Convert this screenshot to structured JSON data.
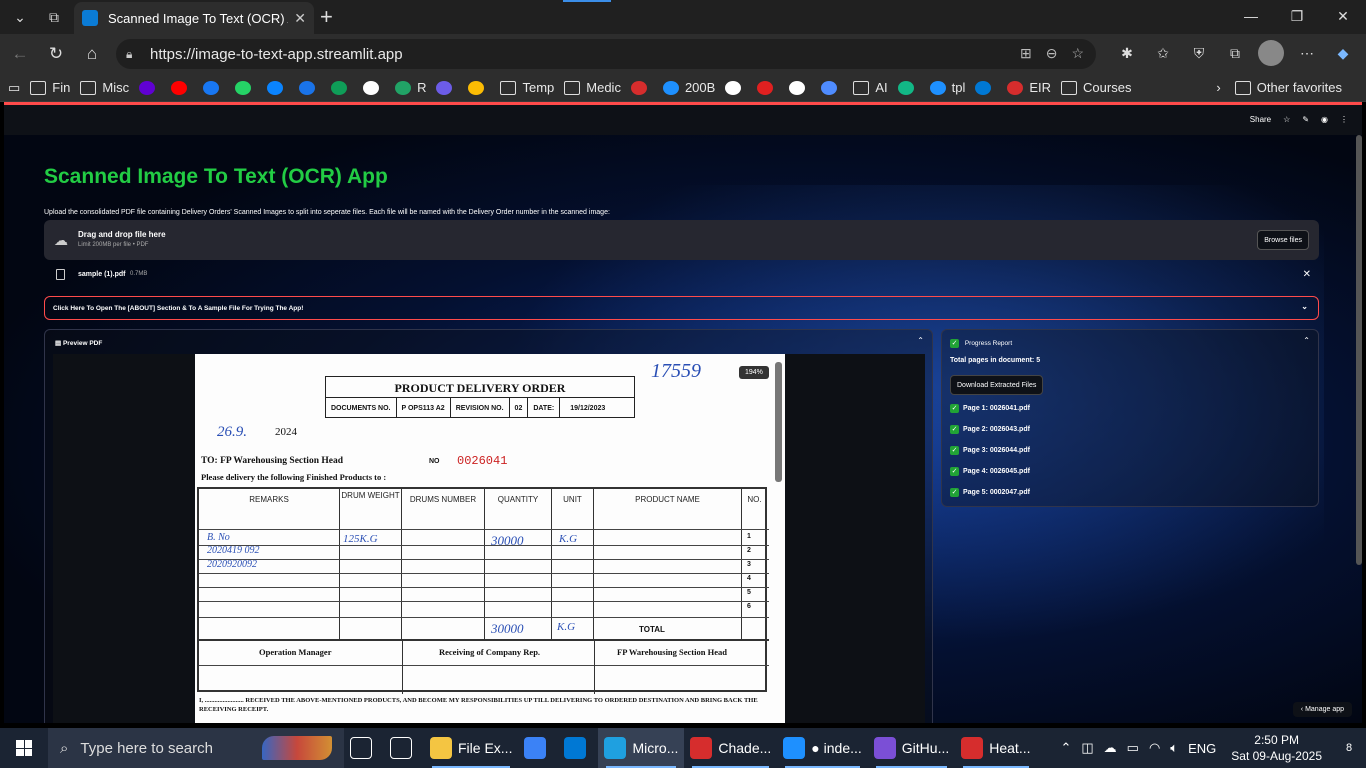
{
  "browser": {
    "tab_title": "Scanned Image To Text (OCR) App",
    "url": "https://image-to-text-app.streamlit.app",
    "favorites": [
      {
        "label": "Fin",
        "icon": "folder-icon"
      },
      {
        "label": "Misc",
        "icon": "folder-icon"
      },
      {
        "label": "",
        "icon": "yahoo-icon",
        "color": "#6001d2"
      },
      {
        "label": "",
        "icon": "youtube-icon",
        "color": "#ff0000"
      },
      {
        "label": "",
        "icon": "facebook-icon",
        "color": "#1877f2"
      },
      {
        "label": "",
        "icon": "whatsapp-icon",
        "color": "#25d366"
      },
      {
        "label": "",
        "icon": "messenger-icon",
        "color": "#0a84ff"
      },
      {
        "label": "",
        "icon": "calendar-icon",
        "color": "#1a73e8"
      },
      {
        "label": "",
        "icon": "chart-icon",
        "color": "#0f9d58"
      },
      {
        "label": "",
        "icon": "wikipedia-icon",
        "color": "#ffffff"
      },
      {
        "label": "R",
        "icon": "sheet-icon",
        "color": "#21a366"
      },
      {
        "label": "",
        "icon": "polygon-icon",
        "color": "#6c5ce7"
      },
      {
        "label": "",
        "icon": "drive-icon",
        "color": "#fbbc04"
      },
      {
        "label": "Temp",
        "icon": "folder-icon"
      },
      {
        "label": "Medic",
        "icon": "folder-icon"
      },
      {
        "label": "",
        "icon": "briefcase-icon",
        "color": "#d62d2d"
      },
      {
        "label": "200B",
        "icon": "bookmark-icon",
        "color": "#1e90ff"
      },
      {
        "label": "",
        "icon": "github-icon",
        "color": "#ffffff"
      },
      {
        "label": "",
        "icon": "crown-icon",
        "color": "#e02020"
      },
      {
        "label": "",
        "icon": "openai-icon",
        "color": "#ffffff"
      },
      {
        "label": "",
        "icon": "gemini-icon",
        "color": "#4f8cff"
      },
      {
        "label": "AI",
        "icon": "folder-icon"
      },
      {
        "label": "",
        "icon": "pen-icon",
        "color": "#12b886"
      },
      {
        "label": "tpl",
        "icon": "text-icon",
        "color": "#1e90ff"
      },
      {
        "label": "",
        "icon": "outlook-icon",
        "color": "#0078d4"
      },
      {
        "label": "EIR",
        "icon": "maple-icon",
        "color": "#d62d2d"
      },
      {
        "label": "Courses",
        "icon": "folder-icon"
      }
    ],
    "other_favorites": "Other favorites"
  },
  "streamlit": {
    "share_label": "Share",
    "title": "Scanned Image To Text (OCR) App",
    "description": "Upload the consolidated PDF file containing Delivery Orders' Scanned Images to split into seperate files. Each file will be named with the Delivery Order number in the scanned image:",
    "uploader": {
      "main": "Drag and drop file here",
      "sub": "Limit 200MB per file • PDF",
      "browse": "Browse files"
    },
    "file": {
      "name": "sample (1).pdf",
      "size": "0.7MB"
    },
    "about_expander": "Click Here To Open The [ABOUT] Section & To A Sample File For Trying The App!",
    "preview_label": "Preview PDF",
    "zoom": "194%",
    "progress": {
      "label": "Progress Report",
      "total": "Total pages in document: 5",
      "download": "Download Extracted Files",
      "items": [
        "Page 1: 0026041.pdf",
        "Page 2: 0026043.pdf",
        "Page 3: 0026044.pdf",
        "Page 4: 0026045.pdf",
        "Page 5: 0002047.pdf"
      ]
    },
    "manage_app": "Manage app"
  },
  "document": {
    "hand_number": "17559",
    "title": "PRODUCT DELIVERY ORDER",
    "meta": [
      "DOCUMENTS NO.",
      "P OPS113 A2",
      "REVISION NO.",
      "02",
      "DATE:",
      "19/12/2023"
    ],
    "hand_date": "26.9.",
    "year": "2024",
    "to": "TO: FP Warehousing Section Head",
    "no_label": "NO",
    "no_value": "0026041",
    "please": "Please delivery the following Finished Products to :",
    "headers": [
      "REMARKS",
      "DRUM WEIGHT",
      "DRUMS NUMBER",
      "QUANTITY",
      "UNIT",
      "PRODUCT NAME",
      "NO."
    ],
    "row_numbers": [
      "1",
      "2",
      "3",
      "4",
      "5",
      "6"
    ],
    "hand_remarks": [
      "B. No",
      "2020419 092",
      "2020920092"
    ],
    "hand_weight": "125K.G",
    "hand_qty": "30000",
    "hand_unit": "K.G",
    "hand_total_qty": "30000",
    "hand_total_unit": "K.G",
    "total_label": "TOTAL",
    "signatures": [
      "Operation Manager",
      "Receiving of Company Rep.",
      "FP Warehousing Section Head"
    ],
    "footer": "I, ........................ RECEIVED THE ABOVE-MENTIONED PRODUCTS, AND BECOME MY RESPONSIBILITIES UP TILL DELIVERING TO ORDERED DESTINATION AND BRING BACK THE RECEIVING RECEIPT."
  },
  "taskbar": {
    "search_placeholder": "Type here to search",
    "apps": [
      {
        "label": "",
        "icon": "task-view-icon"
      },
      {
        "label": "",
        "icon": "copilot-icon"
      },
      {
        "label": "File Ex...",
        "icon": "file-explorer-icon",
        "color": "#f4c542"
      },
      {
        "label": "",
        "icon": "store-icon",
        "color": "#3b82f6"
      },
      {
        "label": "",
        "icon": "outlook-icon",
        "color": "#0078d4"
      },
      {
        "label": "Micro...",
        "icon": "edge-icon",
        "color": "#1fa0e0"
      },
      {
        "label": "Chade...",
        "icon": "pdf-icon",
        "color": "#d62d2d"
      },
      {
        "label": "● inde...",
        "icon": "vscode-icon",
        "color": "#1e90ff"
      },
      {
        "label": "GitHu...",
        "icon": "github-desktop-icon",
        "color": "#7b4fd6"
      },
      {
        "label": "Heat...",
        "icon": "heat-icon",
        "color": "#d62d2d"
      }
    ],
    "language": "ENG",
    "time": "2:50 PM",
    "date": "Sat 09-Aug-2025",
    "notifications": "8"
  }
}
